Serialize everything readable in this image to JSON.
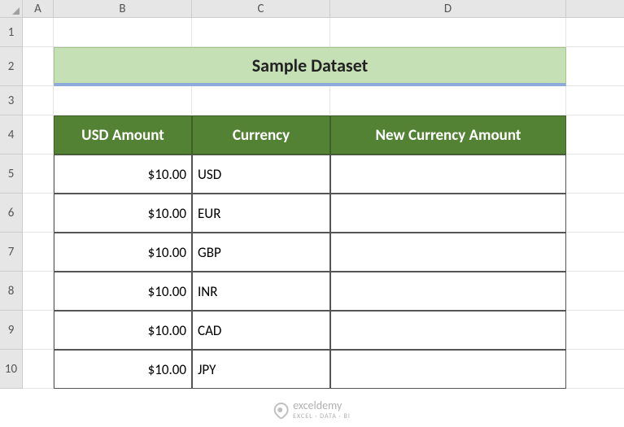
{
  "columns": [
    "A",
    "B",
    "C",
    "D"
  ],
  "rows": [
    "1",
    "2",
    "3",
    "4",
    "5",
    "6",
    "7",
    "8",
    "9",
    "10"
  ],
  "title": "Sample Dataset",
  "headers": {
    "b": "USD Amount",
    "c": "Currency",
    "d": "New Currency Amount"
  },
  "data": [
    {
      "amount": "$10.00",
      "currency": "USD",
      "new": ""
    },
    {
      "amount": "$10.00",
      "currency": "EUR",
      "new": ""
    },
    {
      "amount": "$10.00",
      "currency": "GBP",
      "new": ""
    },
    {
      "amount": "$10.00",
      "currency": "INR",
      "new": ""
    },
    {
      "amount": "$10.00",
      "currency": "CAD",
      "new": ""
    },
    {
      "amount": "$10.00",
      "currency": "JPY",
      "new": ""
    }
  ],
  "watermark": {
    "name": "exceldemy",
    "tag": "EXCEL · DATA · BI"
  }
}
